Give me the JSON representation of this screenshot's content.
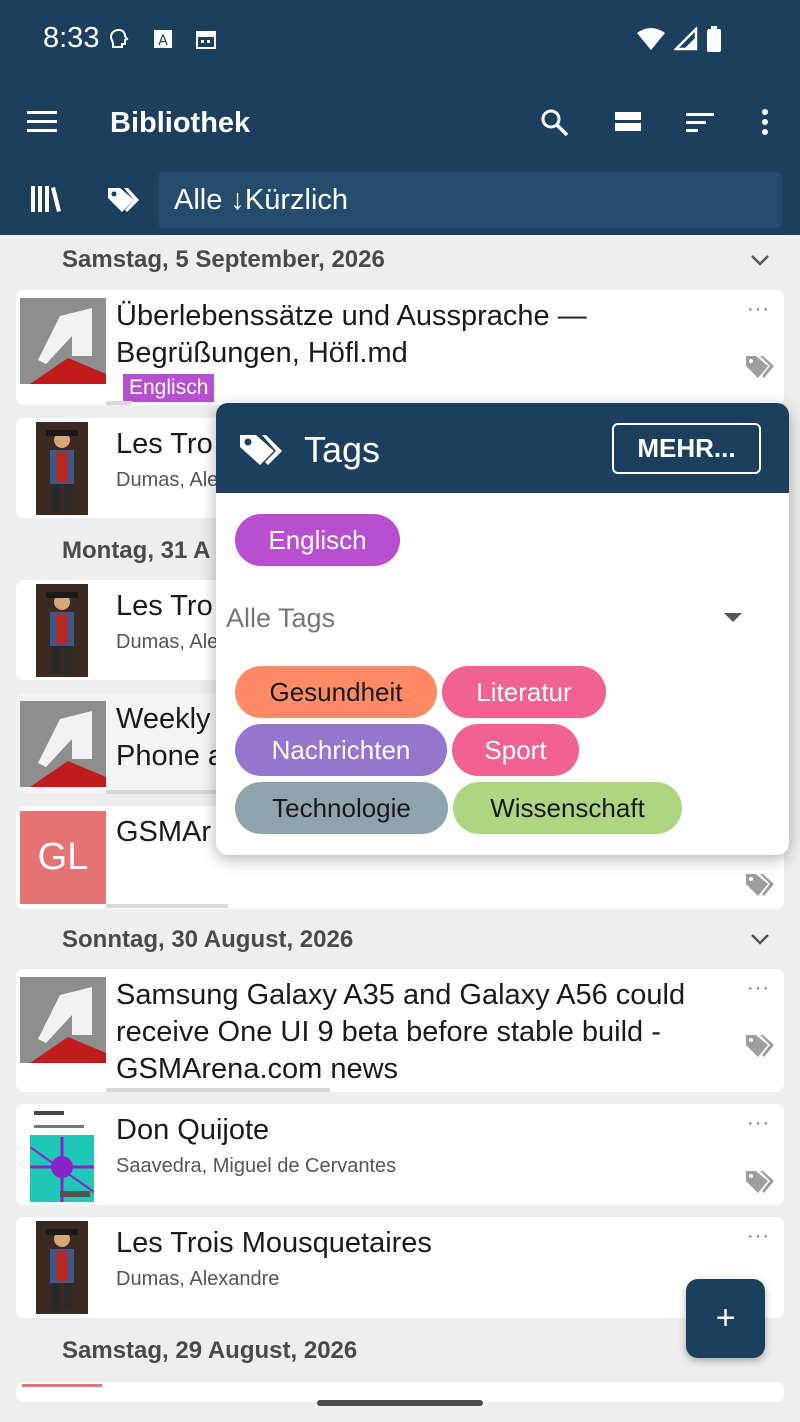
{
  "status_bar": {
    "time": "8:33"
  },
  "app_bar": {
    "title": "Bibliothek",
    "filter_text": "Alle ↓Kürzlich"
  },
  "list": {
    "dates": [
      "Samstag, 5 September, 2026",
      "Montag, 31 A",
      "Sonntag, 30 August, 2026",
      "Samstag, 29 August, 2026"
    ],
    "items": [
      {
        "title_line1": "Überlebenssätze und Aussprache —",
        "title_line2": "Begrüßungen, Höfl.md",
        "tag": "Englisch"
      },
      {
        "title": "Les Tro",
        "author": "Dumas, Ale"
      },
      {
        "title": "Les Tro",
        "author": "Dumas, Ale"
      },
      {
        "title_line1": "Weekly",
        "title_line2": "Phone a"
      },
      {
        "title": "GSMAr",
        "initials": "GL"
      },
      {
        "title_line1": "Samsung Galaxy A35 and Galaxy A56 could",
        "title_line2": "receive One UI 9 beta before stable build -",
        "title_line3": "GSMArena.com news"
      },
      {
        "title": "Don Quijote",
        "author": "Saavedra, Miguel de Cervantes"
      },
      {
        "title": "Les Trois Mousquetaires",
        "author": "Dumas, Alexandre"
      }
    ]
  },
  "popup": {
    "title": "Tags",
    "more_button": "MEHR...",
    "selected_tag": "Englisch",
    "select_placeholder": "Alle Tags",
    "tags": [
      "Gesundheit",
      "Literatur",
      "Nachrichten",
      "Sport",
      "Technologie",
      "Wissenschaft"
    ]
  },
  "fab": {
    "label": "+"
  },
  "colors": {
    "primary": "#1b3f5c",
    "tag_englisch": "#b74fd0",
    "tag_gesundheit": "#ff8a65",
    "tag_literatur": "#f06292",
    "tag_nachrichten": "#9575cd",
    "tag_sport": "#f06292",
    "tag_technologie": "#90a4ae",
    "tag_wissenschaft": "#aed581"
  }
}
